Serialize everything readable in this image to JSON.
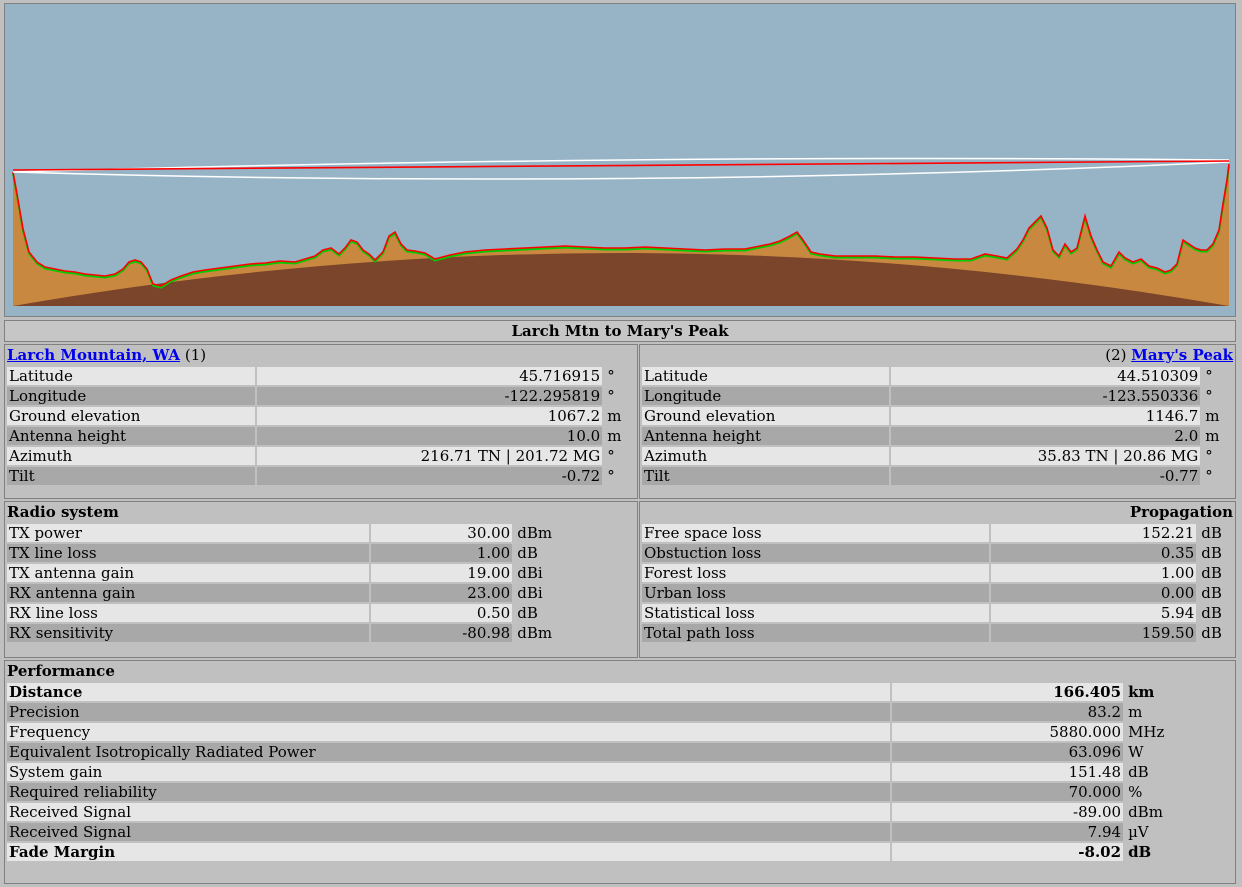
{
  "colors": {
    "sky": "#97b4c6",
    "terrain": "#c8883f",
    "earth": "#7a452a",
    "profile_line": "#ff0000",
    "clear": "#ffffff",
    "vegetation": "#00cc00",
    "obstruction": "#ffff00"
  },
  "title": "Larch Mtn to Mary's Peak",
  "site1": {
    "link": "Larch Mountain, WA",
    "index": "(1)",
    "rows": [
      {
        "label": "Latitude",
        "value": "45.716915",
        "unit": "°"
      },
      {
        "label": "Longitude",
        "value": "-122.295819",
        "unit": "°"
      },
      {
        "label": "Ground elevation",
        "value": "1067.2",
        "unit": "m"
      },
      {
        "label": "Antenna height",
        "value": "10.0",
        "unit": "m"
      },
      {
        "label": "Azimuth",
        "value": "216.71 TN | 201.72 MG",
        "unit": "°"
      },
      {
        "label": "Tilt",
        "value": "-0.72",
        "unit": "°"
      }
    ]
  },
  "site2": {
    "link": "Mary's Peak",
    "index": "(2)",
    "rows": [
      {
        "label": "Latitude",
        "value": "44.510309",
        "unit": "°"
      },
      {
        "label": "Longitude",
        "value": "-123.550336",
        "unit": "°"
      },
      {
        "label": "Ground elevation",
        "value": "1146.7",
        "unit": "m"
      },
      {
        "label": "Antenna height",
        "value": "2.0",
        "unit": "m"
      },
      {
        "label": "Azimuth",
        "value": "35.83 TN | 20.86 MG",
        "unit": "°"
      },
      {
        "label": "Tilt",
        "value": "-0.77",
        "unit": "°"
      }
    ]
  },
  "radio": {
    "title": "Radio system",
    "rows": [
      {
        "label": "TX power",
        "value": "30.00",
        "unit": "dBm"
      },
      {
        "label": "TX line loss",
        "value": "1.00",
        "unit": "dB"
      },
      {
        "label": "TX antenna gain",
        "value": "19.00",
        "unit": "dBi"
      },
      {
        "label": "RX antenna gain",
        "value": "23.00",
        "unit": "dBi"
      },
      {
        "label": "RX line loss",
        "value": "0.50",
        "unit": "dB"
      },
      {
        "label": "RX sensitivity",
        "value": "-80.98",
        "unit": "dBm"
      }
    ]
  },
  "propagation": {
    "title": "Propagation",
    "rows": [
      {
        "label": "Free space loss",
        "value": "152.21",
        "unit": "dB"
      },
      {
        "label": "Obstuction loss",
        "value": "0.35",
        "unit": "dB"
      },
      {
        "label": "Forest loss",
        "value": "1.00",
        "unit": "dB"
      },
      {
        "label": "Urban loss",
        "value": "0.00",
        "unit": "dB"
      },
      {
        "label": "Statistical loss",
        "value": "5.94",
        "unit": "dB"
      },
      {
        "label": "Total path loss",
        "value": "159.50",
        "unit": "dB"
      }
    ]
  },
  "performance": {
    "title": "Performance",
    "rows": [
      {
        "label": "Distance",
        "value": "166.405",
        "unit": "km",
        "bold": true
      },
      {
        "label": "Precision",
        "value": "83.2",
        "unit": "m"
      },
      {
        "label": "Frequency",
        "value": "5880.000",
        "unit": "MHz"
      },
      {
        "label": "Equivalent Isotropically Radiated Power",
        "value": "63.096",
        "unit": "W"
      },
      {
        "label": "System gain",
        "value": "151.48",
        "unit": "dB"
      },
      {
        "label": "Required reliability",
        "value": "70.000",
        "unit": "%"
      },
      {
        "label": "Received Signal",
        "value": "-89.00",
        "unit": "dBm"
      },
      {
        "label": "Received Signal",
        "value": "7.94",
        "unit": "µV"
      },
      {
        "label": "Fade Margin",
        "value": "-8.02",
        "unit": "dB",
        "bold": true
      }
    ]
  }
}
